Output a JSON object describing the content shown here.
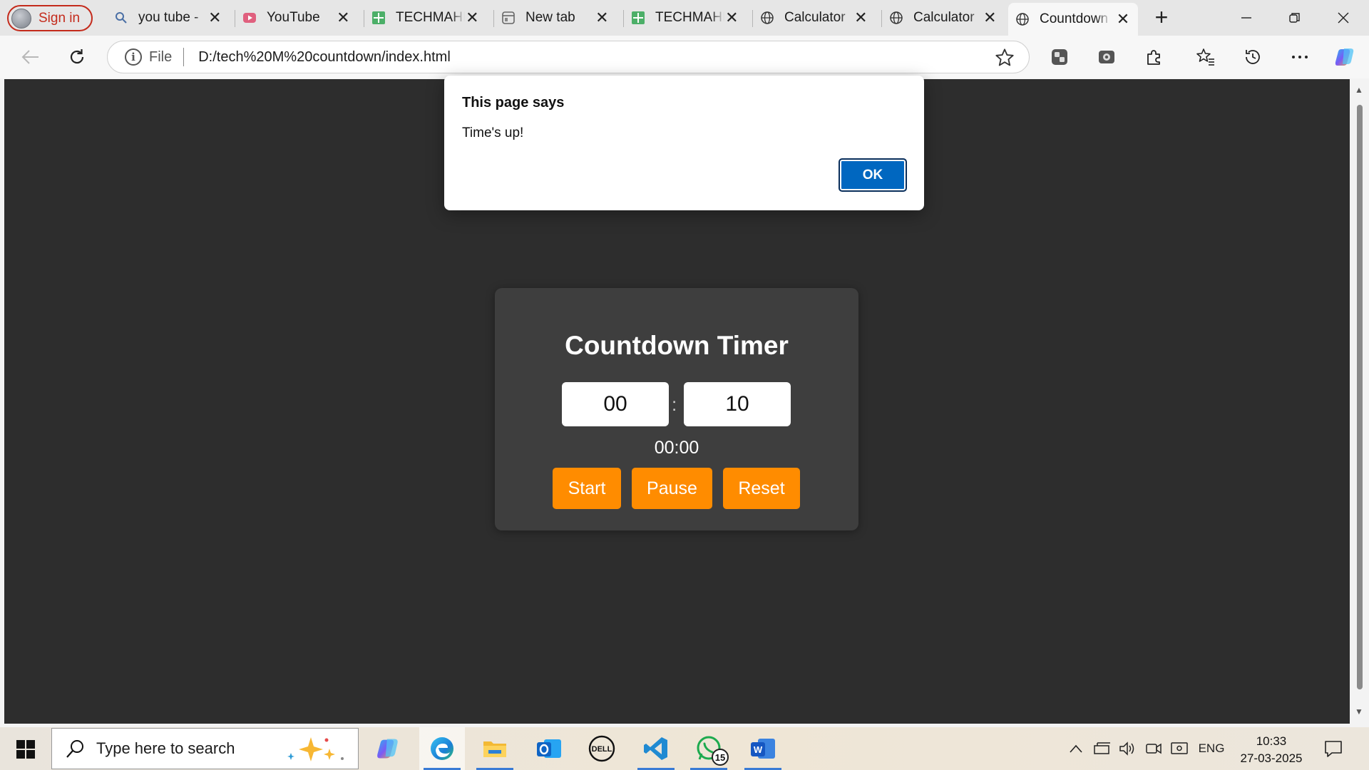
{
  "browser": {
    "profile_label": "Sign in",
    "tabs": [
      {
        "title": "you tube -",
        "icon": "search-icon"
      },
      {
        "title": "YouTube",
        "icon": "youtube-icon"
      },
      {
        "title": "TECHMAHI",
        "icon": "sheets-icon"
      },
      {
        "title": "New tab",
        "icon": "newtab-icon"
      },
      {
        "title": "TECHMAHI",
        "icon": "sheets-icon"
      },
      {
        "title": "Calculator",
        "icon": "globe-icon"
      },
      {
        "title": "Calculator",
        "icon": "globe-icon"
      },
      {
        "title": "Countdown",
        "icon": "globe-icon",
        "active": true
      }
    ],
    "close_glyph": "✕",
    "new_tab_glyph": "+",
    "address": {
      "scheme": "File",
      "url": "D:/tech%20M%20countdown/index.html"
    }
  },
  "dialog": {
    "title": "This page says",
    "message": "Time's up!",
    "ok_label": "OK"
  },
  "timer": {
    "heading": "Countdown Timer",
    "minutes_value": "00",
    "seconds_value": "10",
    "separator": ":",
    "display": "00:00",
    "start_label": "Start",
    "pause_label": "Pause",
    "reset_label": "Reset",
    "accent_color": "#ff8c00"
  },
  "taskbar": {
    "search_placeholder": "Type here to search",
    "whatsapp_badge": "15",
    "language": "ENG",
    "time": "10:33",
    "date": "27-03-2025"
  }
}
